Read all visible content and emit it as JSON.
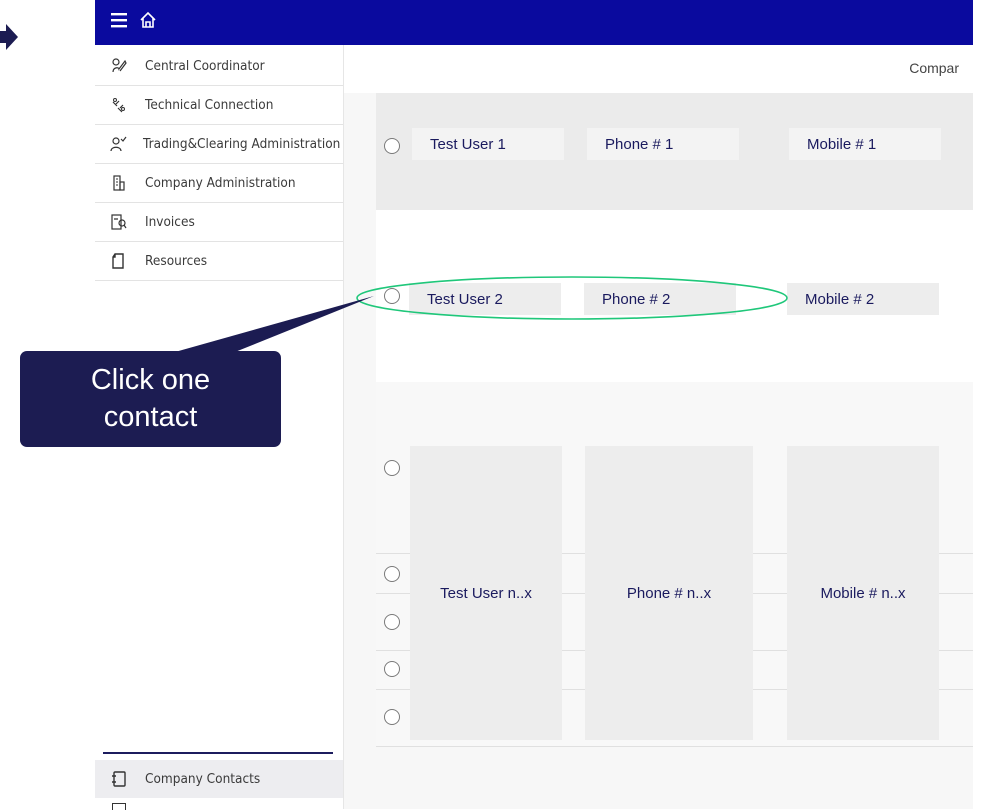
{
  "header": {
    "menu_icon": "hamburger-icon",
    "home_icon": "home-icon"
  },
  "main": {
    "section_title": "Compar"
  },
  "sidebar": {
    "items": [
      {
        "label": "Central Coordinator",
        "icon": "coordinator-icon"
      },
      {
        "label": "Technical Connection",
        "icon": "connection-icon"
      },
      {
        "label": "Trading&Clearing Administration",
        "icon": "user-check-icon"
      },
      {
        "label": "Company Administration",
        "icon": "building-icon"
      },
      {
        "label": "Invoices",
        "icon": "invoice-icon"
      },
      {
        "label": "Resources",
        "icon": "document-icon"
      }
    ],
    "bottom_item": {
      "label": "Company Contacts",
      "icon": "contacts-book-icon"
    }
  },
  "contacts": [
    {
      "name": "Test User 1",
      "phone": "Phone # 1",
      "mobile": "Mobile  # 1"
    },
    {
      "name": "Test User 2",
      "phone": "Phone # 2",
      "mobile": "Mobile  # 2"
    },
    {
      "name": "Test User n..x",
      "phone": "Phone # n..x",
      "mobile": "Mobile  # n..x"
    }
  ],
  "annotation": {
    "callout_line1": "Click one",
    "callout_line2": "contact"
  },
  "colors": {
    "topbar": "#0a0a9e",
    "callout": "#1c1c52",
    "highlight": "#1fc77a"
  }
}
